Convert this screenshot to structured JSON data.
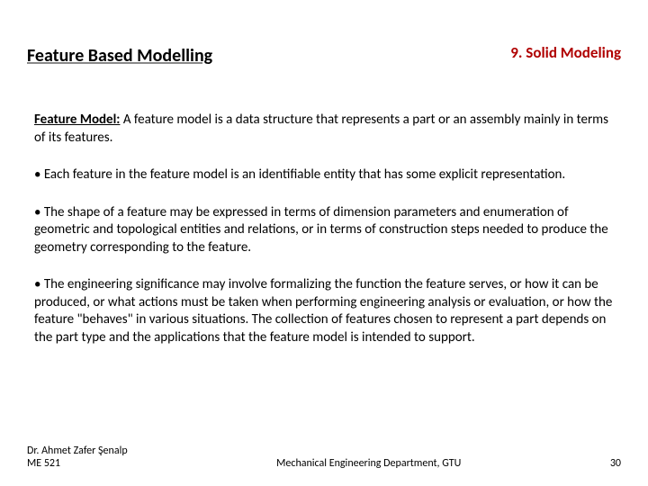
{
  "header": {
    "section_title": "Feature Based Modelling",
    "chapter_title": "9. Solid Modeling"
  },
  "content": {
    "definition_label": "Feature Model:",
    "definition_text": " A feature model is a data structure that represents a part or an assembly mainly in terms of its features.",
    "bullets": [
      "• Each feature in the feature model is an identifiable entity that has some explicit representation.",
      "• The shape of a feature may be expressed in terms of dimension parameters and enumeration of geometric and topological entities and relations, or in terms of construction steps needed to produce the geometry corresponding to the feature.",
      "• The engineering significance may involve formalizing the function the feature serves, or how it can be produced, or what actions must be taken when performing engineering analysis or evaluation, or how the feature \"behaves\" in various situations. The collection of features chosen to represent a part depends on the part type and the applications that the feature model is intended to support."
    ]
  },
  "footer": {
    "author": "Dr. Ahmet Zafer Şenalp",
    "course": "ME 521",
    "department": "Mechanical Engineering Department, GTU",
    "page": "30"
  }
}
